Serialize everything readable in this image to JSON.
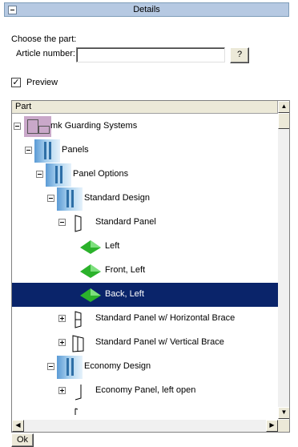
{
  "panel": {
    "title": "Details",
    "choose_label": "Choose the part:",
    "article_label": "Article number:",
    "article_value": "",
    "browse_label": "?",
    "preview_label": "Preview",
    "preview_checked": true,
    "preview_mark": "✓"
  },
  "tree": {
    "column_header": "Part",
    "rows": [
      {
        "label": "mk Guarding Systems",
        "icon": "assembly-icon",
        "expander": "minus"
      },
      {
        "label": "Panels",
        "icon": "folder-icon",
        "expander": "minus"
      },
      {
        "label": "Panel Options",
        "icon": "folder-icon",
        "expander": "minus"
      },
      {
        "label": "Standard Design",
        "icon": "folder-icon",
        "expander": "minus"
      },
      {
        "label": "Standard Panel",
        "icon": "panel-outline-icon",
        "expander": "minus"
      },
      {
        "label": "Left",
        "icon": "green-part-icon",
        "expander": "none"
      },
      {
        "label": "Front, Left",
        "icon": "green-part-icon",
        "expander": "none"
      },
      {
        "label": "Back, Left",
        "icon": "green-part-icon",
        "expander": "none",
        "selected": true
      },
      {
        "label": "Standard Panel w/ Horizontal Brace",
        "icon": "panel-brace-icon",
        "expander": "plus"
      },
      {
        "label": "Standard Panel w/ Vertical Brace",
        "icon": "panel-vbrace-icon",
        "expander": "plus"
      },
      {
        "label": "Economy Design",
        "icon": "folder-icon",
        "expander": "minus"
      },
      {
        "label": "Economy Panel, left open",
        "icon": "panel-open-icon",
        "expander": "plus"
      }
    ]
  },
  "footer": {
    "ok_label": "Ok"
  },
  "colors": {
    "title_bg": "#b6c9e2",
    "selection_bg": "#0a246a",
    "part_green": "#2bb22b"
  }
}
